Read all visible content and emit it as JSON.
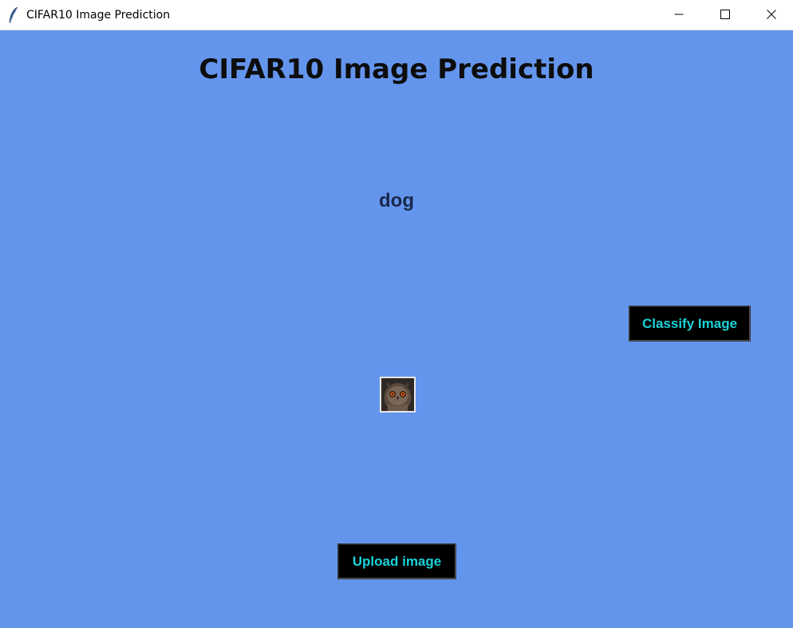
{
  "window": {
    "title": "CIFAR10 Image Prediction",
    "app_icon": "feather-icon",
    "controls": {
      "minimize_icon": "minimize-icon",
      "maximize_icon": "maximize-icon",
      "close_icon": "close-icon"
    }
  },
  "main": {
    "heading": "CIFAR10 Image Prediction",
    "prediction_label": "dog",
    "classify_button": "Classify Image",
    "upload_button": "Upload image",
    "image_thumbnail": "owl-image"
  },
  "colors": {
    "background": "#6495ed",
    "button_bg": "#000000",
    "button_text": "#19d3d8",
    "heading_text": "#0d0d0d",
    "prediction_text": "#182848"
  }
}
